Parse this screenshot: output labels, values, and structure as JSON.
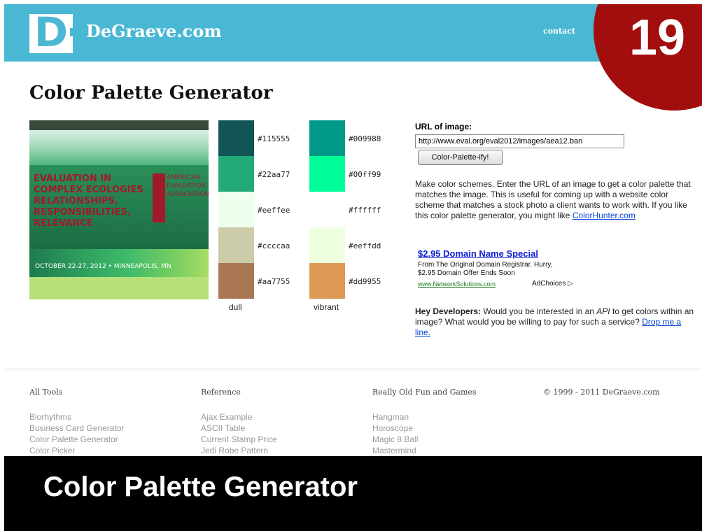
{
  "header": {
    "logo_letter": "D",
    "site_name": "DeGraeve.com",
    "contact_label": "contact"
  },
  "slide": {
    "number": "19"
  },
  "page": {
    "title": "Color Palette Generator"
  },
  "source_image": {
    "left_text": "EVALUATION IN COMPLEX ECOLOGIES RELATIONSHIPS, RESPONSIBILITIES, RELEVANCE",
    "logo_text": "AMERICAN EVALUATION ASSOCIATION",
    "date_text": "OCTOBER 22-27, 2012 • MINNEAPOLIS, MN"
  },
  "palette": {
    "dull_label": "dull",
    "vibrant_label": "vibrant",
    "dull": [
      {
        "hex": "#115555",
        "color": "#115555"
      },
      {
        "hex": "#22aa77",
        "color": "#22aa77"
      },
      {
        "hex": "#eeffee",
        "color": "#eeffee"
      },
      {
        "hex": "#ccccaa",
        "color": "#ccccaa"
      },
      {
        "hex": "#aa7755",
        "color": "#aa7755"
      }
    ],
    "vibrant": [
      {
        "hex": "#009988",
        "color": "#009988"
      },
      {
        "hex": "#00ff99",
        "color": "#00ff99"
      },
      {
        "hex": "#ffffff",
        "color": "#ffffff"
      },
      {
        "hex": "#eeffdd",
        "color": "#eeffdd"
      },
      {
        "hex": "#dd9955",
        "color": "#dd9955"
      }
    ]
  },
  "form": {
    "url_label": "URL of image:",
    "url_value": "http://www.eval.org/eval2012/images/aea12.ban",
    "submit_label": "Color-Palette-ify!"
  },
  "description": {
    "text": "Make color schemes. Enter the URL of an image to get a color palette that matches the image. This is useful for coming up with a website color scheme that matches a stock photo a client wants to work with. If you like this color palette generator, you might like",
    "link": "ColorHunter.com"
  },
  "ad": {
    "title": "$2.95 Domain Name Special",
    "line1": "From The Original Domain Registrar. Hurry,",
    "line2": "$2.95 Domain Offer Ends Soon",
    "url": "www.NetworkSolutions.com",
    "choices": "AdChoices ▷"
  },
  "developers": {
    "bold": "Hey Developers:",
    "text_before_api": "Would you be interested in an",
    "api": "API",
    "text_after_api": "to get colors within an image? What would you be willing to pay for such a service?",
    "link": "Drop me a line."
  },
  "footer": {
    "all_tools": {
      "heading": "All Tools",
      "items": [
        "Biorhythms",
        "Business Card Generator",
        "Color Palette Generator",
        "Color Picker"
      ]
    },
    "reference": {
      "heading": "Reference",
      "items": [
        "Ajax Example",
        "ASCII Table",
        "Current Stamp Price",
        "Jedi Robe Pattern"
      ]
    },
    "games": {
      "heading": "Really Old Fun and Games",
      "items": [
        "Hangman",
        "Horoscope",
        "Magic 8 Ball",
        "Mastermind"
      ]
    },
    "copyright": "© 1999 - 2011 DeGraeve.com"
  },
  "caption": {
    "text": "Color Palette Generator"
  },
  "colors": {
    "header_bg": "#4ab8d4",
    "slide_circle": "#a20d0d",
    "caption_bg": "#000000",
    "link_blue": "#0645d6"
  }
}
